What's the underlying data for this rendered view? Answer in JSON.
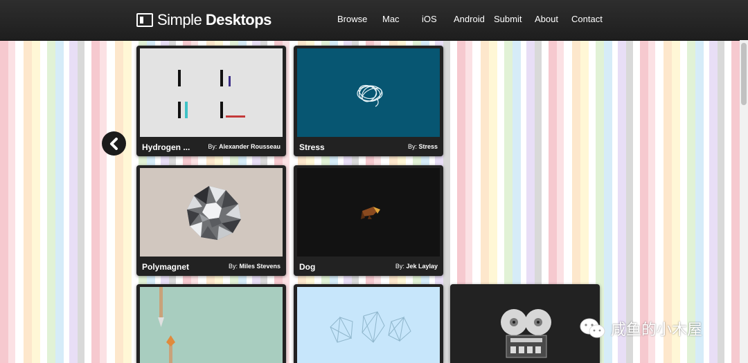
{
  "header": {
    "logo_light": "Simple ",
    "logo_bold": "Desktops",
    "nav": [
      "Browse",
      "Mac",
      "iOS",
      "Android",
      "Submit",
      "About",
      "Contact"
    ]
  },
  "prev_icon": "chevron-left-icon",
  "cards": [
    {
      "title": "Hydrogen ...",
      "by": "By:",
      "author": "Alexander Rousseau"
    },
    {
      "title": "Stress",
      "by": "By:",
      "author": "Stress"
    },
    {
      "title": "Polymagnet",
      "by": "By:",
      "author": "Miles Stevens"
    },
    {
      "title": "Dog",
      "by": "By:",
      "author": "Jek Laylay"
    }
  ],
  "watermark": {
    "text": "咸鱼的小木屋",
    "icon": "wechat-icon"
  },
  "colors": {
    "header_bg": "#262626",
    "card_bg": "#222222",
    "hydrogen_bg": "#e3e3e3",
    "stress_bg": "#075672",
    "polymagnet_bg": "#d1c7bf",
    "dog_bg": "#121212",
    "arrow_card_bg": "#a8cdbf",
    "polygon_card_bg": "#c7e6fb",
    "tape_card_bg": "#222222"
  }
}
